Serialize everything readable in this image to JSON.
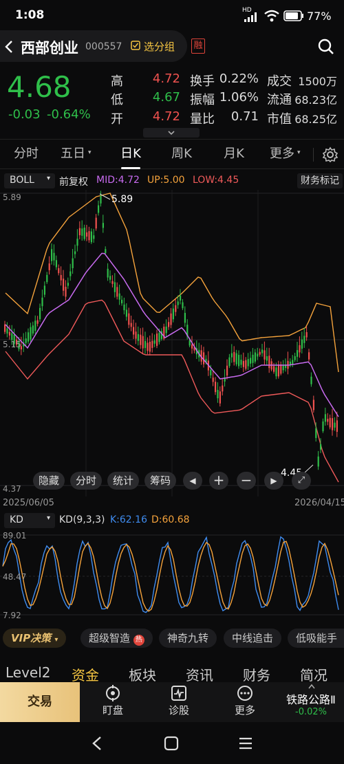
{
  "status_bar": {
    "time": "1:08",
    "network": "HD",
    "battery": "77"
  },
  "header": {
    "stock_name": "西部创业",
    "stock_code": "000557",
    "watchlist_label": "选分组",
    "margin_badge": "融"
  },
  "quote": {
    "price": "4.68",
    "change": "-0.03",
    "change_pct": "-0.64%",
    "rows": [
      {
        "l1": "高",
        "v1": "4.72",
        "l2": "换手",
        "v2": "0.22%",
        "l3": "成交",
        "v3": "1500万"
      },
      {
        "l1": "低",
        "v1": "4.67",
        "l2": "振幅",
        "v2": "1.06%",
        "l3": "流通",
        "v3": "68.23亿"
      },
      {
        "l1": "开",
        "v1": "4.72",
        "l2": "量比",
        "v2": "0.71",
        "l3": "市值",
        "v3": "68.25亿"
      }
    ],
    "colors": {
      "up": "#f0524f",
      "down": "#2fbf4a"
    }
  },
  "period_tabs": [
    "分时",
    "五日",
    "日K",
    "周K",
    "月K",
    "更多"
  ],
  "active_tab": "日K",
  "indicator_bar": {
    "name": "BOLL",
    "adjust": "前复权",
    "mid": "MID:4.72",
    "up": "UP:5.00",
    "low": "LOW:4.45",
    "finance_label": "财务标记"
  },
  "chart_data": [
    {
      "type": "candlestick",
      "y_axis_labels": [
        "5.89",
        "5.15",
        "4.37"
      ],
      "ylim": [
        4.37,
        5.89
      ],
      "annotations": {
        "high": "5.89",
        "low": "4.45"
      },
      "x_start_label": "2025/06/05",
      "x_end_label": "2026/04/15",
      "overlays": [
        "BOLL MID",
        "BOLL UP",
        "BOLL LOW"
      ],
      "colors": {
        "up": "#f0524f",
        "down": "#2fbf4a",
        "mid": "#c86bf0",
        "upper": "#f5a33c",
        "lower": "#f05a5a"
      }
    },
    {
      "type": "line",
      "y_axis_labels": [
        "89.01",
        "48.47",
        "7.92"
      ],
      "ylim": [
        7.92,
        89.01
      ],
      "series": [
        {
          "name": "K",
          "last": "62.16"
        },
        {
          "name": "D",
          "last": "60.68"
        }
      ],
      "colors": {
        "K": "#3f8cf0",
        "D": "#f5a33c"
      }
    }
  ],
  "chart_controls": [
    "隐藏",
    "分时",
    "统计",
    "筹码"
  ],
  "kd_bar": {
    "name": "KD",
    "params": "KD(9,3,3)",
    "k": "K:62.16",
    "d": "D:60.68"
  },
  "feature_bar": {
    "vip": "VIP决策",
    "items": [
      "超级智造",
      "神奇九转",
      "中线追击",
      "低吸能手"
    ],
    "hot_badge": "热"
  },
  "bottom_tabs": [
    "Level2",
    "资金",
    "板块",
    "资讯",
    "财务",
    "简况"
  ],
  "bottom_nav": {
    "trade": "交易",
    "items": [
      {
        "label": "盯盘",
        "icon": "target-icon"
      },
      {
        "label": "诊股",
        "icon": "pulse-icon"
      },
      {
        "label": "更多",
        "icon": "more-icon"
      }
    ],
    "related": {
      "name": "铁路公路Ⅱ",
      "change": "-0.02%"
    }
  }
}
